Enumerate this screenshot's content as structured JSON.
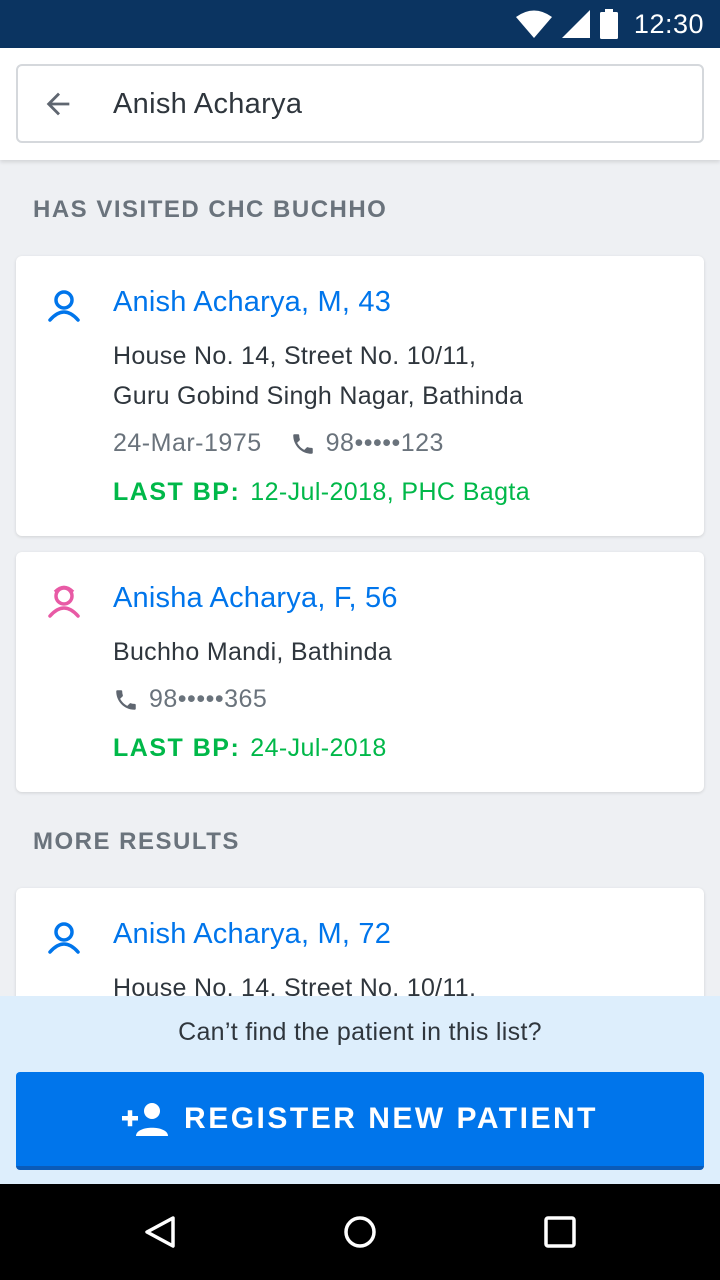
{
  "status_bar": {
    "time": "12:30",
    "icons": [
      "wifi-icon",
      "signal-icon",
      "battery-icon"
    ]
  },
  "search": {
    "back_icon": "arrow-back-icon",
    "value": "Anish Acharya"
  },
  "sections": [
    {
      "title": "HAS VISITED CHC BUCHHO",
      "results": [
        {
          "icon": "patient-male-icon",
          "name": "Anish Acharya, M, 43",
          "address_lines": [
            "House No. 14, Street No. 10/11,",
            "Guru Gobind Singh Nagar, Bathinda"
          ],
          "dob": "24-Mar-1975",
          "phone": "98•••••123",
          "last_bp_label": "LAST BP:",
          "last_bp_value": "12-Jul-2018, PHC Bagta"
        },
        {
          "icon": "patient-female-icon",
          "name": "Anisha Acharya, F, 56",
          "address_lines": [
            "Buchho Mandi, Bathinda"
          ],
          "phone": "98•••••365",
          "last_bp_label": "LAST BP:",
          "last_bp_value": "24-Jul-2018"
        }
      ]
    },
    {
      "title": "MORE RESULTS",
      "results": [
        {
          "icon": "patient-male-icon",
          "name": "Anish Acharya, M, 72",
          "address_lines": [
            "House No. 14, Street No. 10/11,"
          ]
        }
      ]
    }
  ],
  "footer": {
    "prompt": "Can’t find the patient in this list?",
    "register_icon": "add-person-icon",
    "register_label": "REGISTER NEW PATIENT"
  },
  "nav_bar": {
    "icons": [
      "back-triangle-icon",
      "home-circle-icon",
      "recents-square-icon"
    ]
  },
  "colors": {
    "status_bar": "#0b3461",
    "primary": "#0075eb",
    "female_accent": "#e85aa5",
    "success": "#00b849",
    "footer_bg": "#ddeefc"
  }
}
